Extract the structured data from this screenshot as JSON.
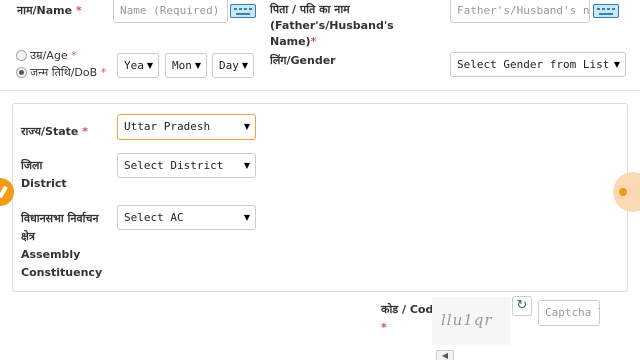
{
  "name": {
    "label": "नाम/Name",
    "required_mark": "*",
    "placeholder": "Name (Required)"
  },
  "relative_name": {
    "label_line1": "पिता / पति का नाम (Father's/Husband's",
    "label_line2": "Name)",
    "required_mark": "*",
    "placeholder": "Father's/Husband's name"
  },
  "age_option": {
    "label": "उम्र/Age",
    "required_mark": "*"
  },
  "dob_option": {
    "label": "जन्म तिथि/DoB",
    "required_mark": "*"
  },
  "dob": {
    "year": "Yea",
    "month": "Mon",
    "day": "Day"
  },
  "gender": {
    "label": "लिंग/Gender",
    "value": "Select Gender from List"
  },
  "state": {
    "label": "राज्य/State",
    "required_mark": "*",
    "value": "Uttar Pradesh"
  },
  "district": {
    "label_line1": "जिला",
    "label_line2": "District",
    "value": "Select District"
  },
  "ac": {
    "label_line1": "विधानसभा निर्वाचन",
    "label_line2": "क्षेत्र",
    "label_line3": "Assembly",
    "label_line4": "Constituency",
    "value": "Select AC"
  },
  "captcha": {
    "label": "कोड / Code",
    "required_mark": "*",
    "image_text": "llu1qr",
    "placeholder": "Captcha Te"
  },
  "icons": {
    "keyboard": "keyboard-icon",
    "refresh": "refresh-icon",
    "audio": "speaker-icon",
    "dropdown": "triangle-down"
  },
  "colors": {
    "required": "#d9534f",
    "focus_border": "#e8a33d",
    "accent": "#f39c12",
    "keyboard_fill": "#c9e6f5"
  }
}
